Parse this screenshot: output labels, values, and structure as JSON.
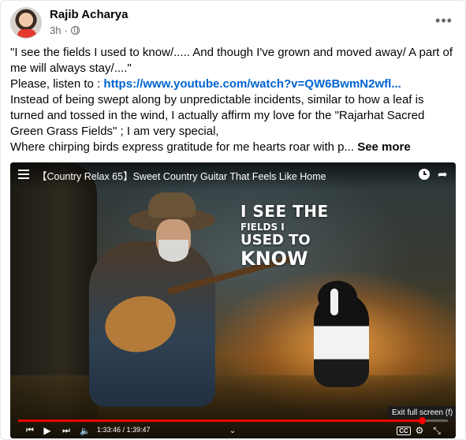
{
  "post": {
    "author": "Rajib Acharya",
    "time": "3h",
    "more_label": "•••",
    "lines": [
      "\"I see the fields I used to know/..... And though I've grown and moved away/ A part of",
      "me will always stay/....\"",
      "Please, listen to : ",
      "Instead of being swept along by unpredictable incidents, similar to how a leaf is",
      "turned and tossed in the wind, I actually affirm my love for the \"Rajarhat Sacred",
      "Green Grass Fields\" ; I am very special,",
      "Where chirping birds express gratitude for me hearts roar with p... "
    ],
    "link_text": "https://www.youtube.com/watch?v=QW6BwmN2wfl...",
    "see_more": "See more"
  },
  "video": {
    "title": "【Country Relax 65】Sweet Country Guitar That Feels Like Home",
    "overlay": [
      "I SEE THE",
      "FIELDS I",
      "USED TO",
      "KNOW"
    ],
    "tooltip": "Exit full screen (f)",
    "time_display": "1:33:46 / 1:39:47",
    "progress": 0.94,
    "cc_label": "CC"
  }
}
